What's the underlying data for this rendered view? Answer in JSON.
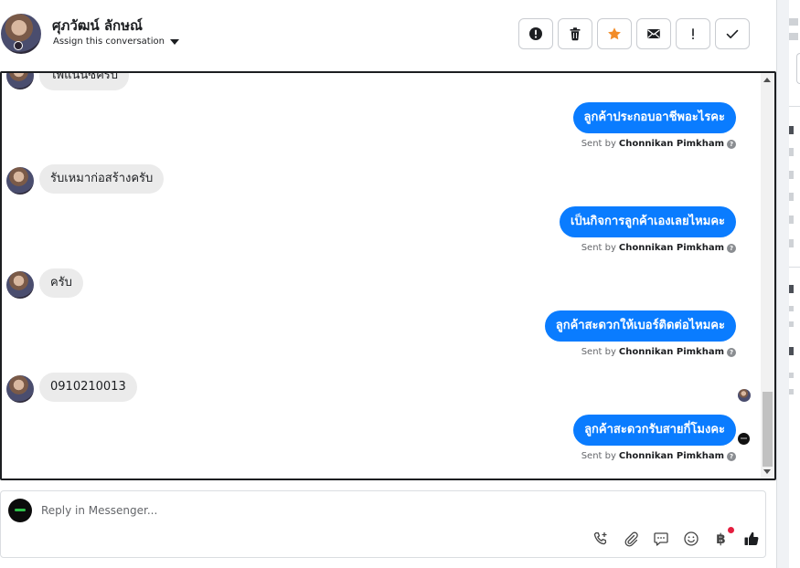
{
  "header": {
    "contact_name": "ศุภวัฒน์ ลักษณ์",
    "assign_label": "Assign this conversation",
    "actions": [
      {
        "name": "report-button",
        "icon": "alert-circle-icon"
      },
      {
        "name": "delete-button",
        "icon": "trash-icon"
      },
      {
        "name": "star-button",
        "icon": "star-icon"
      },
      {
        "name": "mark-unread-button",
        "icon": "envelope-icon"
      },
      {
        "name": "follow-up-button",
        "icon": "exclamation-icon"
      },
      {
        "name": "mark-done-button",
        "icon": "checkmark-icon"
      }
    ]
  },
  "messages": [
    {
      "dir": "in",
      "text": "ไพ้แนนซ์ครับ"
    },
    {
      "dir": "out",
      "text": "ลูกค้าประกอบอาชีพอะไรคะ",
      "sent_by_prefix": "Sent by",
      "agent": "Chonnikan Pimkham"
    },
    {
      "dir": "in",
      "text": "รับเหมาก่อสร้างครับ"
    },
    {
      "dir": "out",
      "text": "เป็นกิจการลูกค้าเองเลยไหมคะ",
      "sent_by_prefix": "Sent by",
      "agent": "Chonnikan Pimkham"
    },
    {
      "dir": "in",
      "text": "ครับ"
    },
    {
      "dir": "out",
      "text": "ลูกค้าสะดวกให้เบอร์ติดต่อไหมคะ",
      "sent_by_prefix": "Sent by",
      "agent": "Chonnikan Pimkham"
    },
    {
      "dir": "in",
      "text": "0910210013"
    },
    {
      "dir": "out",
      "text": "ลูกค้าสะดวกรับสายกี่โมงคะ",
      "sent_by_prefix": "Sent by",
      "agent": "Chonnikan Pimkham"
    }
  ],
  "reply": {
    "placeholder": "Reply in Messenger...",
    "tools": [
      "phone-add-icon",
      "paperclip-icon",
      "chat-bubble-icon",
      "emoji-icon",
      "baht-icon",
      "thumbs-up-icon"
    ],
    "baht_symbol": "฿"
  },
  "colors": {
    "outgoing_bubble": "#0a7cff",
    "incoming_bubble": "#ebebeb",
    "star_accent": "#f28c28",
    "notification_dot": "#e41e3f"
  }
}
